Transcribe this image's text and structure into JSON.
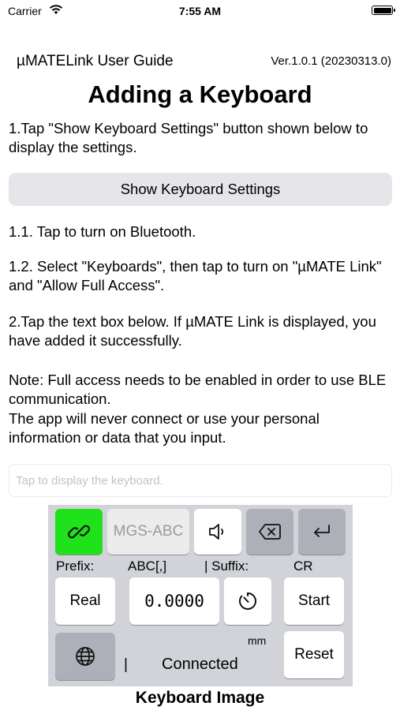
{
  "status_bar": {
    "carrier": "Carrier",
    "time": "7:55 AM"
  },
  "header": {
    "app_name": "µMATELink User  Guide",
    "version": "Ver.1.0.1 (20230313.0)",
    "title": "Adding a Keyboard"
  },
  "steps": {
    "step1": "1.Tap \"Show Keyboard Settings\" button shown below to display the settings.",
    "show_button": "Show Keyboard Settings",
    "step1_1": "1.1. Tap to turn on Bluetooth.",
    "step1_2": "1.2. Select \"Keyboards\", then tap to turn on \"µMATE Link\" and \"Allow Full Access\".",
    "step2": "2.Tap the text box below. If µMATE Link is displayed, you have added it successfully.",
    "note_line1": "Note: Full access needs to be enabled in order to use BLE communication.",
    "note_line2": "The app will never connect or use your personal information or data that you  input."
  },
  "text_box": {
    "placeholder": "Tap to display the keyboard."
  },
  "keyboard": {
    "device_key": "MGS-ABC",
    "prefix_label": "Prefix:",
    "prefix_value": "ABC[,]",
    "suffix_label": "| Suffix:",
    "suffix_value": "CR",
    "real_key": "Real",
    "value_display": "0.0000",
    "start_key": "Start",
    "unit": "mm",
    "separator": "|",
    "connection_status": "Connected",
    "reset_key": "Reset",
    "link_color": "#1fe21a",
    "caption": "Keyboard Image"
  }
}
